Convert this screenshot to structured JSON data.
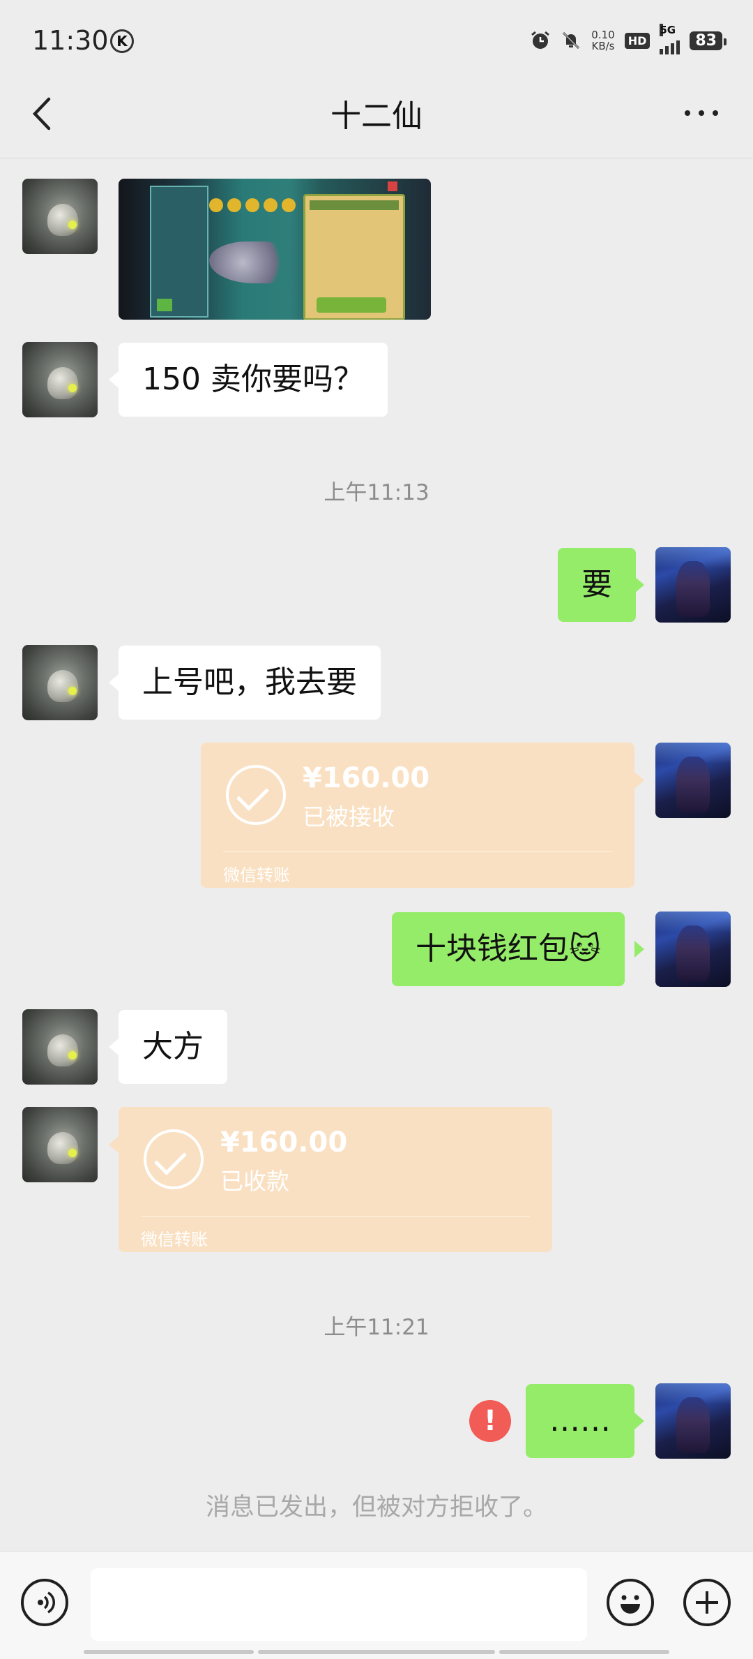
{
  "status_bar": {
    "time": "11:30",
    "k_badge": "K",
    "net_speed_value": "0.10",
    "net_speed_unit": "KB/s",
    "hd": "HD",
    "network": "5G",
    "battery": "83",
    "icons": [
      "alarm-icon",
      "mute-icon",
      "signal-icon",
      "battery-icon"
    ]
  },
  "nav": {
    "title": "十二仙",
    "back_icon": "back-arrow-icon",
    "more_icon": "more-icon"
  },
  "messages": {
    "m1_text": "150 卖你要吗？",
    "ts1": "上午11:13",
    "m2_text": "要",
    "m3_text": "上号吧，我去要",
    "transfer1": {
      "amount": "¥160.00",
      "status": "已被接收",
      "label": "微信转账"
    },
    "m4_text": "十块钱红包",
    "m4_emoji": "🐱",
    "m5_text": "大方",
    "transfer2": {
      "amount": "¥160.00",
      "status": "已收款",
      "label": "微信转账"
    },
    "ts2": "上午11:21",
    "m6_text": "……",
    "error_mark": "!",
    "rejected_note": "消息已发出，但被对方拒收了。"
  },
  "input_bar": {
    "voice_icon": "voice-icon",
    "emoji_icon": "emoji-icon",
    "plus_icon": "plus-icon"
  },
  "colors": {
    "background": "#ededed",
    "outgoing_bubble": "#95ec69",
    "incoming_bubble": "#ffffff",
    "transfer_card": "#fae0c2",
    "error": "#f25c56"
  }
}
